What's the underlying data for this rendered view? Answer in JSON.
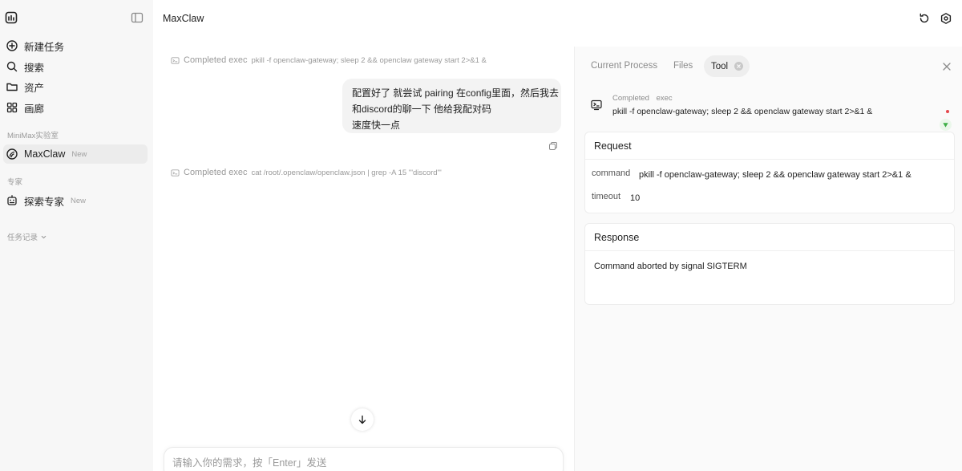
{
  "app": {
    "title": "MaxClaw"
  },
  "sidebar": {
    "items": [
      {
        "label": "新建任务",
        "icon": "plus-circle-icon"
      },
      {
        "label": "搜索",
        "icon": "search-icon"
      },
      {
        "label": "资产",
        "icon": "folder-icon"
      },
      {
        "label": "画廊",
        "icon": "grid-icon"
      }
    ],
    "section_lab": "MiniMax实验室",
    "lab_item": {
      "label": "MaxClaw",
      "badge": "New",
      "icon": "claw-icon"
    },
    "section_expert": "专家",
    "expert_item": {
      "label": "探索专家",
      "badge": "New",
      "icon": "robot-icon"
    },
    "history_label": "任务记录"
  },
  "chat": {
    "exec1": {
      "status": "Completed exec",
      "command": "pkill -f openclaw-gateway; sleep 2 && openclaw gateway start 2>&1 &"
    },
    "user_message": {
      "lines": [
        "配置好了 就尝试 pairing 在config里面，然后我去",
        "和discord的聊一下 他给我配对码",
        "速度快一点"
      ]
    },
    "exec2": {
      "status": "Completed exec",
      "command": "cat /root/.openclaw/openclaw.json | grep -A 15 '\"discord\"'"
    },
    "input_placeholder": "请输入你的需求，按「Enter」发送"
  },
  "panel": {
    "tabs": {
      "current": "Current Process",
      "files": "Files",
      "tool": "Tool"
    },
    "tool_head": {
      "status": "Completed",
      "kind": "exec",
      "command": "pkill -f openclaw-gateway; sleep 2 && openclaw gateway start 2>&1 &"
    },
    "request": {
      "title": "Request",
      "command_key": "command",
      "command_value": "pkill -f openclaw-gateway; sleep 2 && openclaw gateway start 2>&1 &",
      "timeout_key": "timeout",
      "timeout_value": "10"
    },
    "response": {
      "title": "Response",
      "text": "Command aborted by signal SIGTERM"
    }
  },
  "colors": {
    "sidebar_bg": "#f7f7f7",
    "bubble_bg": "#f3f3f3",
    "panel_bg": "#fafafa",
    "alert_dot": "#e5484d"
  }
}
